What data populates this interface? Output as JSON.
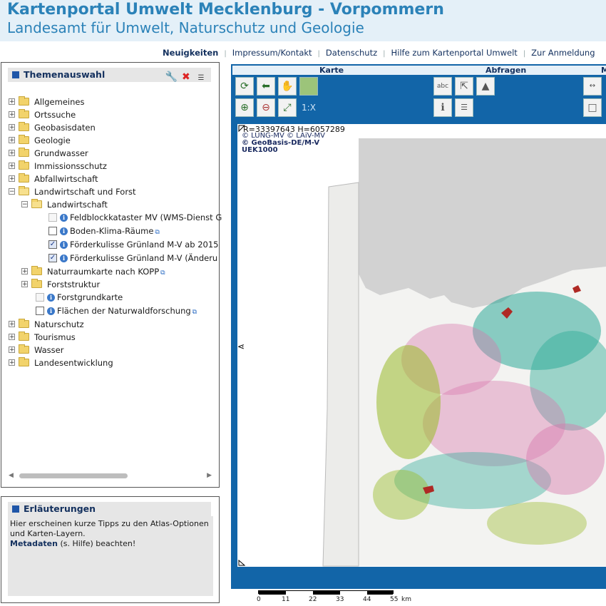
{
  "header": {
    "title": "Kartenportal Umwelt Mecklenburg - Vorpommern",
    "subtitle": "Landesamt für Umwelt, Naturschutz und Geologie"
  },
  "nav": {
    "items": [
      "Neuigkeiten",
      "Impressum/Kontakt",
      "Datenschutz",
      "Hilfe zum Kartenportal Umwelt",
      "Zur Anmeldung"
    ]
  },
  "themes_panel": {
    "title": "Themenauswahl",
    "tree": [
      {
        "label": "Allgemeines"
      },
      {
        "label": "Ortssuche"
      },
      {
        "label": "Geobasisdaten"
      },
      {
        "label": "Geologie"
      },
      {
        "label": "Grundwasser"
      },
      {
        "label": "Immissionsschutz"
      },
      {
        "label": "Abfallwirtschaft"
      },
      {
        "label": "Landwirtschaft und Forst"
      },
      {
        "label": "Landwirtschaft"
      },
      {
        "label": "Feldblockkataster MV (WMS-Dienst G"
      },
      {
        "label": "Boden-Klima-Räume"
      },
      {
        "label": "Förderkulisse Grünland M-V ab 2015"
      },
      {
        "label": "Förderkulisse Grünland M-V (Änderu"
      },
      {
        "label": "Naturraumkarte nach KOPP"
      },
      {
        "label": "Forststruktur"
      },
      {
        "label": "Forstgrundkarte"
      },
      {
        "label": "Flächen der Naturwaldforschung"
      },
      {
        "label": "Naturschutz"
      },
      {
        "label": "Tourismus"
      },
      {
        "label": "Wasser"
      },
      {
        "label": "Landesentwicklung"
      }
    ]
  },
  "info_panel": {
    "title": "Erläuterungen",
    "text": "Hier erscheinen kurze Tipps zu den Atlas-Optionen und Karten-Layern.",
    "metadata_bold": "Metadaten",
    "metadata_rest": "(s. Hilfe) beachten!"
  },
  "map": {
    "tabs": [
      "Karte",
      "Abfragen",
      "M"
    ],
    "scale_btn": "1:X",
    "coordinates": "R=33397643 H=6057289",
    "attribution1": "© LUNG-MV © LAiV-MV",
    "attribution2": "© GeoBasis-DE/M-V",
    "attribution3": "UEK1000",
    "scale_labels": [
      "0",
      "11",
      "22",
      "33",
      "44",
      "55",
      "km"
    ]
  },
  "colors": {
    "header_bg": "#e4f0f8",
    "header_text": "#2b82b8",
    "map_frame": "#1265a8",
    "layer_green": "#8fb514",
    "layer_teal": "#1aa38f",
    "layer_pink": "#d56aa4",
    "layer_red": "#a8140e"
  }
}
